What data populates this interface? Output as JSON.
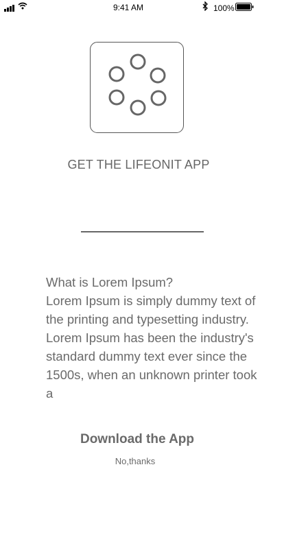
{
  "status_bar": {
    "time": "9:41 AM",
    "battery": "100%",
    "icons": [
      "signal-icon",
      "wifi-icon",
      "bluetooth-icon",
      "battery-icon"
    ]
  },
  "logo": {
    "icon": "dots-ring-icon"
  },
  "title": "GET THE LIFEONIT APP",
  "description": {
    "heading": "What is Lorem Ipsum?",
    "body": "Lorem Ipsum is simply dummy text of the printing and typesetting industry. Lorem Ipsum has been the industry's standard dummy text ever since the 1500s, when an unknown printer took a"
  },
  "actions": {
    "download_label": "Download the App",
    "dismiss_label": "No,thanks"
  }
}
